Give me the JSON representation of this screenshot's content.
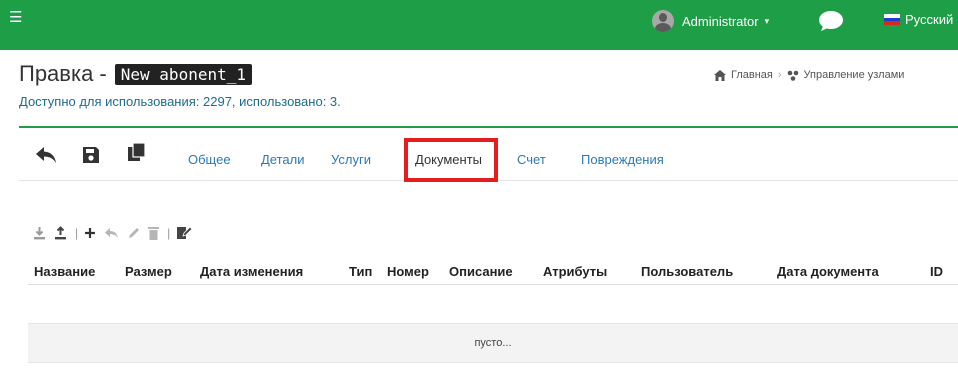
{
  "header": {
    "menu_icon": "hamburger-icon",
    "user_name": "Administrator",
    "user_caret": "▾",
    "chat_icon": "chat-bubble-icon",
    "language": "Русский",
    "accent_color": "#1f9e48"
  },
  "page": {
    "title": "Правка -",
    "object_name": "New abonent_1",
    "usage": "Доступно для использования: 2297, использовано: 3."
  },
  "breadcrumb": {
    "home": "Главная",
    "section": "Управление узлами"
  },
  "toolbar": {
    "back_icon": "back-arrow-icon",
    "save_icon": "save-icon",
    "copy_icon": "copy-icon",
    "tabs": [
      {
        "label": "Общее"
      },
      {
        "label": "Детали"
      },
      {
        "label": "Услуги"
      },
      {
        "label": "Документы",
        "active": true
      },
      {
        "label": "Счет"
      },
      {
        "label": "Повреждения"
      }
    ],
    "highlight_color": "#e41e1e"
  },
  "grid": {
    "tools": [
      "download-icon",
      "upload-icon",
      "add-icon",
      "reply-icon",
      "edit-icon",
      "delete-icon",
      "sign-icon"
    ],
    "columns": [
      "Название",
      "Размер",
      "Дата изменения",
      "Тип",
      "Номер",
      "Описание",
      "Атрибуты",
      "Пользователь",
      "Дата документа",
      "ID"
    ],
    "empty_text": "пусто..."
  }
}
